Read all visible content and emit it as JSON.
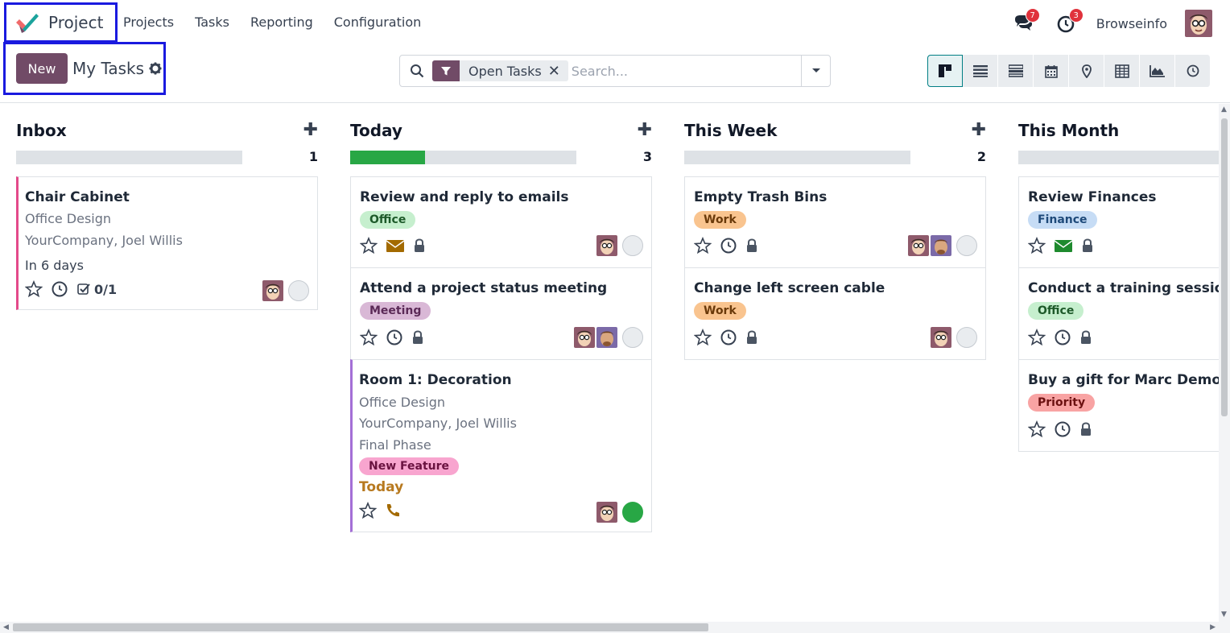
{
  "app": {
    "name": "Project",
    "logo_icon": "project-logo-icon"
  },
  "menu": [
    "Projects",
    "Tasks",
    "Reporting",
    "Configuration"
  ],
  "systray": {
    "messages_count": "7",
    "activities_count": "3",
    "company": "Browseinfo"
  },
  "control_panel": {
    "new_label": "New",
    "title": "My Tasks"
  },
  "search": {
    "facet": "Open Tasks",
    "placeholder": "Search..."
  },
  "views": [
    "kanban-view-icon",
    "list-view-icon",
    "activity-view-icon",
    "calendar-view-icon",
    "map-view-icon",
    "pivot-view-icon",
    "graph-view-icon",
    "activity-clock-view-icon"
  ],
  "columns": [
    {
      "title": "Inbox",
      "count": "1",
      "progress": 0,
      "cards": [
        {
          "title": "Chair Cabinet",
          "sub1": "Office Design",
          "sub2": "YourCompany, Joel Willis",
          "deadline": "In 6 days",
          "subtasks": "0/1"
        }
      ]
    },
    {
      "title": "Today",
      "count": "3",
      "progress": 0.33,
      "cards": [
        {
          "title": "Review and reply to emails",
          "tag": "Office"
        },
        {
          "title": "Attend a project status meeting",
          "tag": "Meeting"
        },
        {
          "title": "Room 1: Decoration",
          "sub1": "Office Design",
          "sub2": "YourCompany, Joel Willis",
          "sub3": "Final Phase",
          "tag": "New Feature",
          "deadline": "Today"
        }
      ]
    },
    {
      "title": "This Week",
      "count": "2",
      "progress": 0,
      "cards": [
        {
          "title": "Empty Trash Bins",
          "tag": "Work"
        },
        {
          "title": "Change left screen cable",
          "tag": "Work"
        }
      ]
    },
    {
      "title": "This Month",
      "count": "",
      "progress": 0,
      "cards": [
        {
          "title": "Review Finances",
          "tag": "Finance"
        },
        {
          "title": "Conduct a training session",
          "tag": "Office"
        },
        {
          "title": "Buy a gift for Marc Demo's",
          "tag": "Priority"
        }
      ]
    }
  ],
  "colors": {
    "brand": "#714b67",
    "accent": "#017e84",
    "progress": "#28a745",
    "badge": "#e0323c",
    "highlight_box": "#1a1adf"
  }
}
